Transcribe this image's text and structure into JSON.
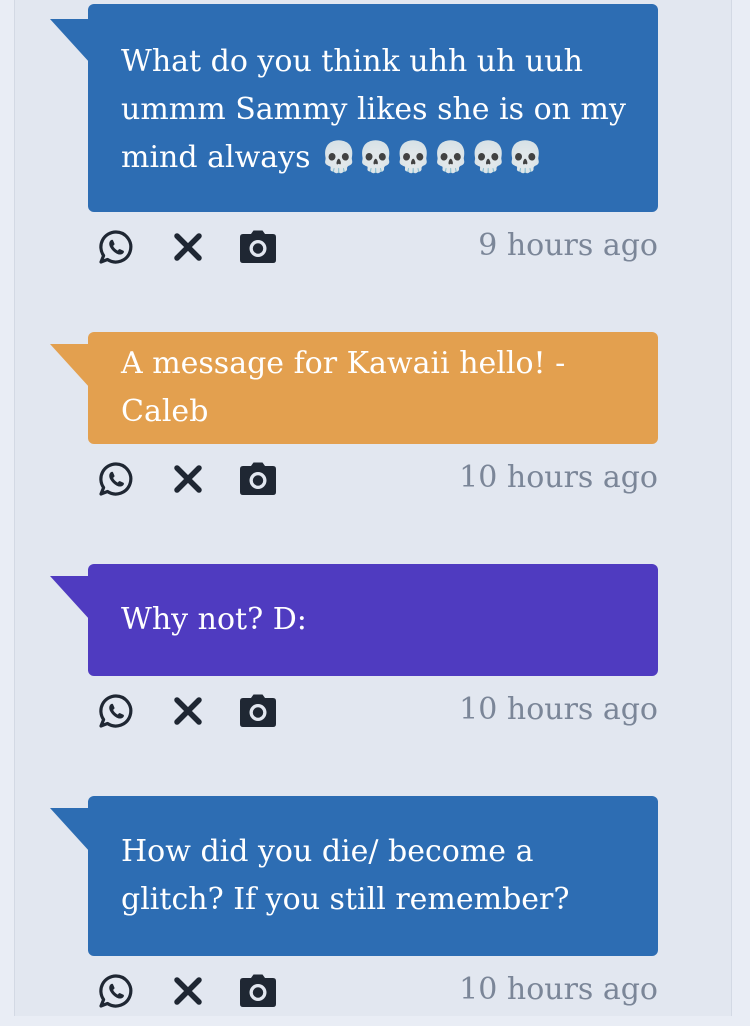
{
  "messages": [
    {
      "text": "What do you think uhh uh uuh ummm Sammy likes she is on my mind always 💀💀💀💀💀💀",
      "time": "9 hours ago",
      "color": "#2d6db3"
    },
    {
      "text": "A message for Kawaii hello! -Caleb",
      "time": "10 hours ago",
      "color": "#e3a04f"
    },
    {
      "text": "Why not? D:",
      "time": "10 hours ago",
      "color": "#4f3bc0"
    },
    {
      "text": "How did you die/ become a glitch? If you still remember?",
      "time": "10 hours ago",
      "color": "#2d6db3"
    }
  ],
  "icons": [
    "whatsapp-icon",
    "close-icon",
    "camera-icon"
  ]
}
